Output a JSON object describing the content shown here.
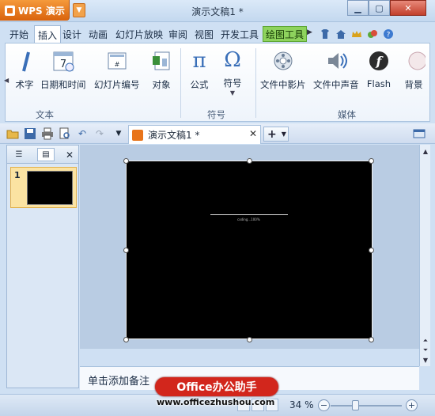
{
  "titlebar": {
    "app_name": "WPS 演示",
    "document_title": "演示文稿1 *",
    "controls": [
      "minimize",
      "maximize",
      "close"
    ]
  },
  "ribbon_tabs": [
    {
      "label": "开始"
    },
    {
      "label": "插入",
      "active": true
    },
    {
      "label": "设计"
    },
    {
      "label": "动画"
    },
    {
      "label": "幻灯片放映"
    },
    {
      "label": "审阅"
    },
    {
      "label": "视图"
    },
    {
      "label": "开发工具"
    },
    {
      "label": "绘图工具",
      "contextual": true
    }
  ],
  "quick_icons": [
    "tshirt-icon",
    "home-icon",
    "crown-icon",
    "leaf-icon",
    "help-icon"
  ],
  "ribbon": {
    "buttons": [
      {
        "label": "术字",
        "icon": "wordart-icon",
        "group": "text"
      },
      {
        "label": "日期和时间",
        "icon": "calendar-icon",
        "group": "text"
      },
      {
        "label": "幻灯片编号",
        "icon": "slide-number-icon",
        "group": "text"
      },
      {
        "label": "对象",
        "icon": "object-icon",
        "group": "text"
      },
      {
        "label": "公式",
        "icon": "pi-icon",
        "group": "symbol"
      },
      {
        "label": "符号",
        "icon": "omega-icon",
        "group": "symbol"
      },
      {
        "label": "文件中影片",
        "icon": "movie-icon",
        "group": "media"
      },
      {
        "label": "文件中声音",
        "icon": "sound-icon",
        "group": "media"
      },
      {
        "label": "Flash",
        "icon": "flash-icon",
        "group": "media"
      },
      {
        "label": "背景",
        "icon": "background-icon",
        "group": "media"
      }
    ],
    "groups": {
      "text": "文本",
      "symbol": "符号",
      "media": "媒体"
    }
  },
  "toolbar": {
    "doc_tab": "演示文稿1 *",
    "new_tab": "+"
  },
  "slides_pane": {
    "thumbnails": [
      {
        "number": "1"
      }
    ]
  },
  "slide": {
    "caption": "coding...100%"
  },
  "notes": {
    "placeholder": "单击添加备注"
  },
  "status": {
    "zoom": "34 %",
    "zoom_level_fraction": 0.34
  },
  "watermark": {
    "badge": "Office办公助手",
    "url": "www.officezhushou.com"
  },
  "colors": {
    "app_orange": "#e8741a",
    "draw_tools_green": "#8ed35d",
    "watermark_red": "#d2261c",
    "slide_bg": "#000000"
  }
}
